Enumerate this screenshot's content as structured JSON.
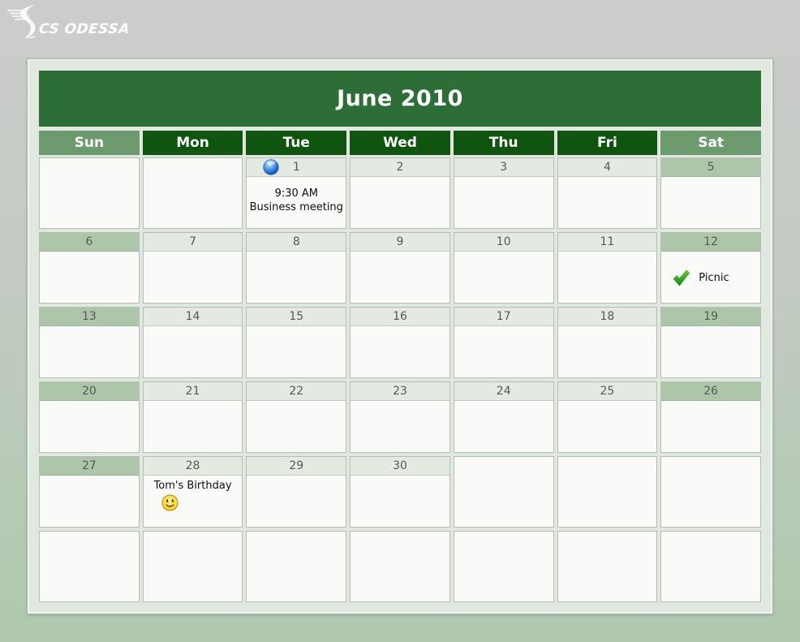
{
  "logo": {
    "text": "CS ODESSA",
    "icon": "tornado-icon"
  },
  "calendar": {
    "title": "June 2010",
    "day_names": [
      "Sun",
      "Mon",
      "Tue",
      "Wed",
      "Thu",
      "Fri",
      "Sat"
    ],
    "weeks": [
      [
        {
          "empty": true
        },
        {
          "empty": true
        },
        {
          "date": "1",
          "kind": "weekday",
          "strip_icon": "blue-ball-icon",
          "event": {
            "align": "center",
            "lines": [
              "9:30 AM",
              "Business meeting"
            ]
          }
        },
        {
          "date": "2",
          "kind": "weekday"
        },
        {
          "date": "3",
          "kind": "weekday"
        },
        {
          "date": "4",
          "kind": "weekday"
        },
        {
          "date": "5",
          "kind": "weekend"
        }
      ],
      [
        {
          "date": "6",
          "kind": "weekend"
        },
        {
          "date": "7",
          "kind": "weekday"
        },
        {
          "date": "8",
          "kind": "weekday"
        },
        {
          "date": "9",
          "kind": "weekday"
        },
        {
          "date": "10",
          "kind": "weekday"
        },
        {
          "date": "11",
          "kind": "weekday"
        },
        {
          "date": "12",
          "kind": "weekend",
          "event": {
            "align": "left",
            "icon": "check-icon",
            "lines": [
              "Picnic"
            ]
          }
        }
      ],
      [
        {
          "date": "13",
          "kind": "weekend"
        },
        {
          "date": "14",
          "kind": "weekday"
        },
        {
          "date": "15",
          "kind": "weekday"
        },
        {
          "date": "16",
          "kind": "weekday"
        },
        {
          "date": "17",
          "kind": "weekday"
        },
        {
          "date": "18",
          "kind": "weekday"
        },
        {
          "date": "19",
          "kind": "weekend"
        }
      ],
      [
        {
          "date": "20",
          "kind": "weekend"
        },
        {
          "date": "21",
          "kind": "weekday"
        },
        {
          "date": "22",
          "kind": "weekday"
        },
        {
          "date": "23",
          "kind": "weekday"
        },
        {
          "date": "24",
          "kind": "weekday"
        },
        {
          "date": "25",
          "kind": "weekday"
        },
        {
          "date": "26",
          "kind": "weekend"
        }
      ],
      [
        {
          "date": "27",
          "kind": "weekend"
        },
        {
          "date": "28",
          "kind": "weekday",
          "event": {
            "align": "stacked",
            "icon": "smiley-icon",
            "lines": [
              "Tom's Birthday"
            ]
          }
        },
        {
          "date": "29",
          "kind": "weekday"
        },
        {
          "date": "30",
          "kind": "weekday"
        },
        {
          "empty": true
        },
        {
          "empty": true
        },
        {
          "empty": true
        }
      ],
      [
        {
          "empty": true
        },
        {
          "empty": true
        },
        {
          "empty": true
        },
        {
          "empty": true
        },
        {
          "empty": true
        },
        {
          "empty": true
        },
        {
          "empty": true
        }
      ]
    ],
    "colors": {
      "title_bar": "#2d6d38",
      "weekday_header": "#0f540f",
      "weekend_header": "#6e9a6f",
      "weekend_strip": "#adc6aa",
      "weekday_strip": "#e4eae2",
      "cell_body": "#fafbf9",
      "panel_bg": "#e1e8e0",
      "page_top": "#cbcdcb",
      "page_bottom": "#afc8af"
    }
  }
}
